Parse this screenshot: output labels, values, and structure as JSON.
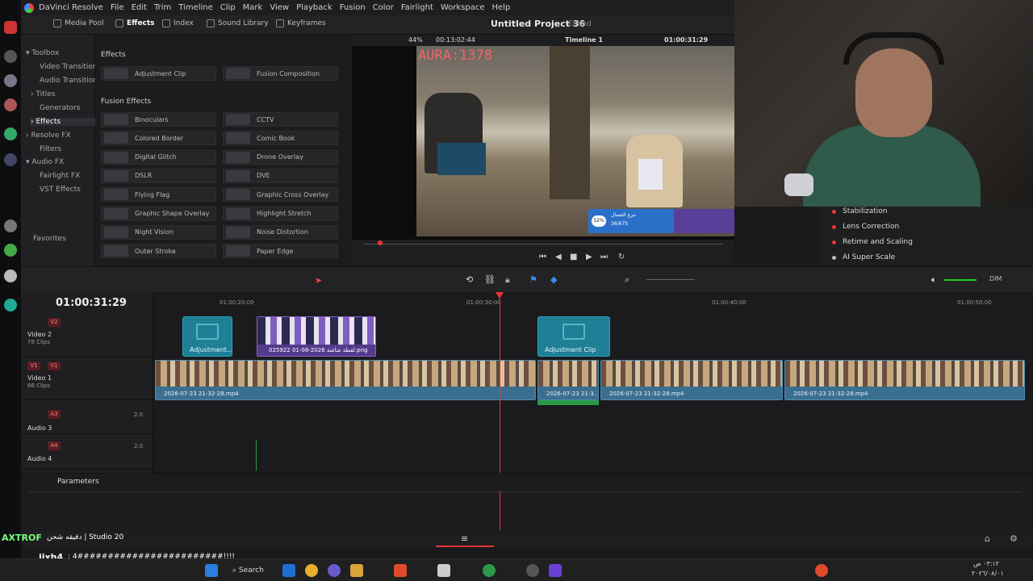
{
  "app": {
    "menu": [
      "DaVinci Resolve",
      "File",
      "Edit",
      "Trim",
      "Timeline",
      "Clip",
      "Mark",
      "View",
      "Playback",
      "Fusion",
      "Color",
      "Fairlight",
      "Workspace",
      "Help"
    ]
  },
  "toolbar": {
    "media_pool": "Media Pool",
    "effects": "Effects",
    "index": "Index",
    "sound_library": "Sound Library",
    "keyframes": "Keyframes",
    "project_title": "Untitled Project 36",
    "project_status": "Edited"
  },
  "toolbox": {
    "items": [
      {
        "label": "Toolbox",
        "expanded": true
      },
      {
        "label": "Video Transitions"
      },
      {
        "label": "Audio Transitions"
      },
      {
        "label": "Titles"
      },
      {
        "label": "Generators"
      },
      {
        "label": "Effects"
      },
      {
        "label": "Resolve FX"
      },
      {
        "label": "Filters"
      },
      {
        "label": "Audio FX"
      },
      {
        "label": "Fairlight FX"
      },
      {
        "label": "VST Effects"
      }
    ],
    "favorites": "Favorites"
  },
  "effects": {
    "header": "Effects",
    "top_items": [
      "Adjustment Clip",
      "Fusion Composition"
    ],
    "fusion_header": "Fusion Effects",
    "fusion_items": [
      "Binoculars",
      "CCTV",
      "Colored Border",
      "Comic Book",
      "Digital Glitch",
      "Drone Overlay",
      "DSLR",
      "DVE",
      "Flying Flag",
      "Graphic Cross Overlay",
      "Graphic Shape Overlay",
      "Highlight Stretch",
      "Night Vision",
      "Noise Distortion",
      "Outer Stroke",
      "Paper Edge"
    ]
  },
  "viewer": {
    "zoom": "44%",
    "source_tc": "00:13:02:44",
    "timeline_name": "Timeline 1",
    "record_tc": "01:00:31:29",
    "overlay_text": "AURA:1378",
    "donation_pct": "52%",
    "donation_count": "36/675",
    "donation_title": "تبرع الشمال"
  },
  "inspector": {
    "items": [
      "Stabilization",
      "Lens Correction",
      "Retime and Scaling",
      "AI Super Scale"
    ]
  },
  "timeline": {
    "timecode": "01:00:31:29",
    "dim": "DIM",
    "ruler": [
      "01:00:20:00",
      "01:00:30:00",
      "01:00:40:00",
      "01:00:50:00"
    ],
    "tracks": [
      {
        "badge": "V2",
        "name": "Video 2",
        "sub": "78 Clips"
      },
      {
        "badge": "V1",
        "name": "Video 1",
        "sub": "66 Clips"
      },
      {
        "badge": "A3",
        "name": "Audio 3",
        "level": "2.0"
      },
      {
        "badge": "A4",
        "name": "Audio 4",
        "level": "2.0"
      }
    ],
    "clips": {
      "adj1": "Adjustment...",
      "img": "لقطة شاشة 2026-08-01 025922.png",
      "adj2": "Adjustment Clip",
      "vid1": "2026-07-23 21-32-28.mp4",
      "vid2": "2026-07-23 21-3...",
      "vid3": "2026-07-23 21-32-28.mp4",
      "vid4": "2026-07-23 21-32-28.mp4"
    }
  },
  "params": {
    "label": "Parameters"
  },
  "chat": {
    "line1_user": "AXTROF",
    "line1_text": "دقيقه شحن | Studio 20",
    "line2_user": "iixh4",
    "line2_text": ": 4########################!!!!"
  },
  "taskbar": {
    "search": "Search",
    "time": "٠٣:١٢ ص",
    "date": "٢٠٢٦/٠٨/٠١"
  }
}
